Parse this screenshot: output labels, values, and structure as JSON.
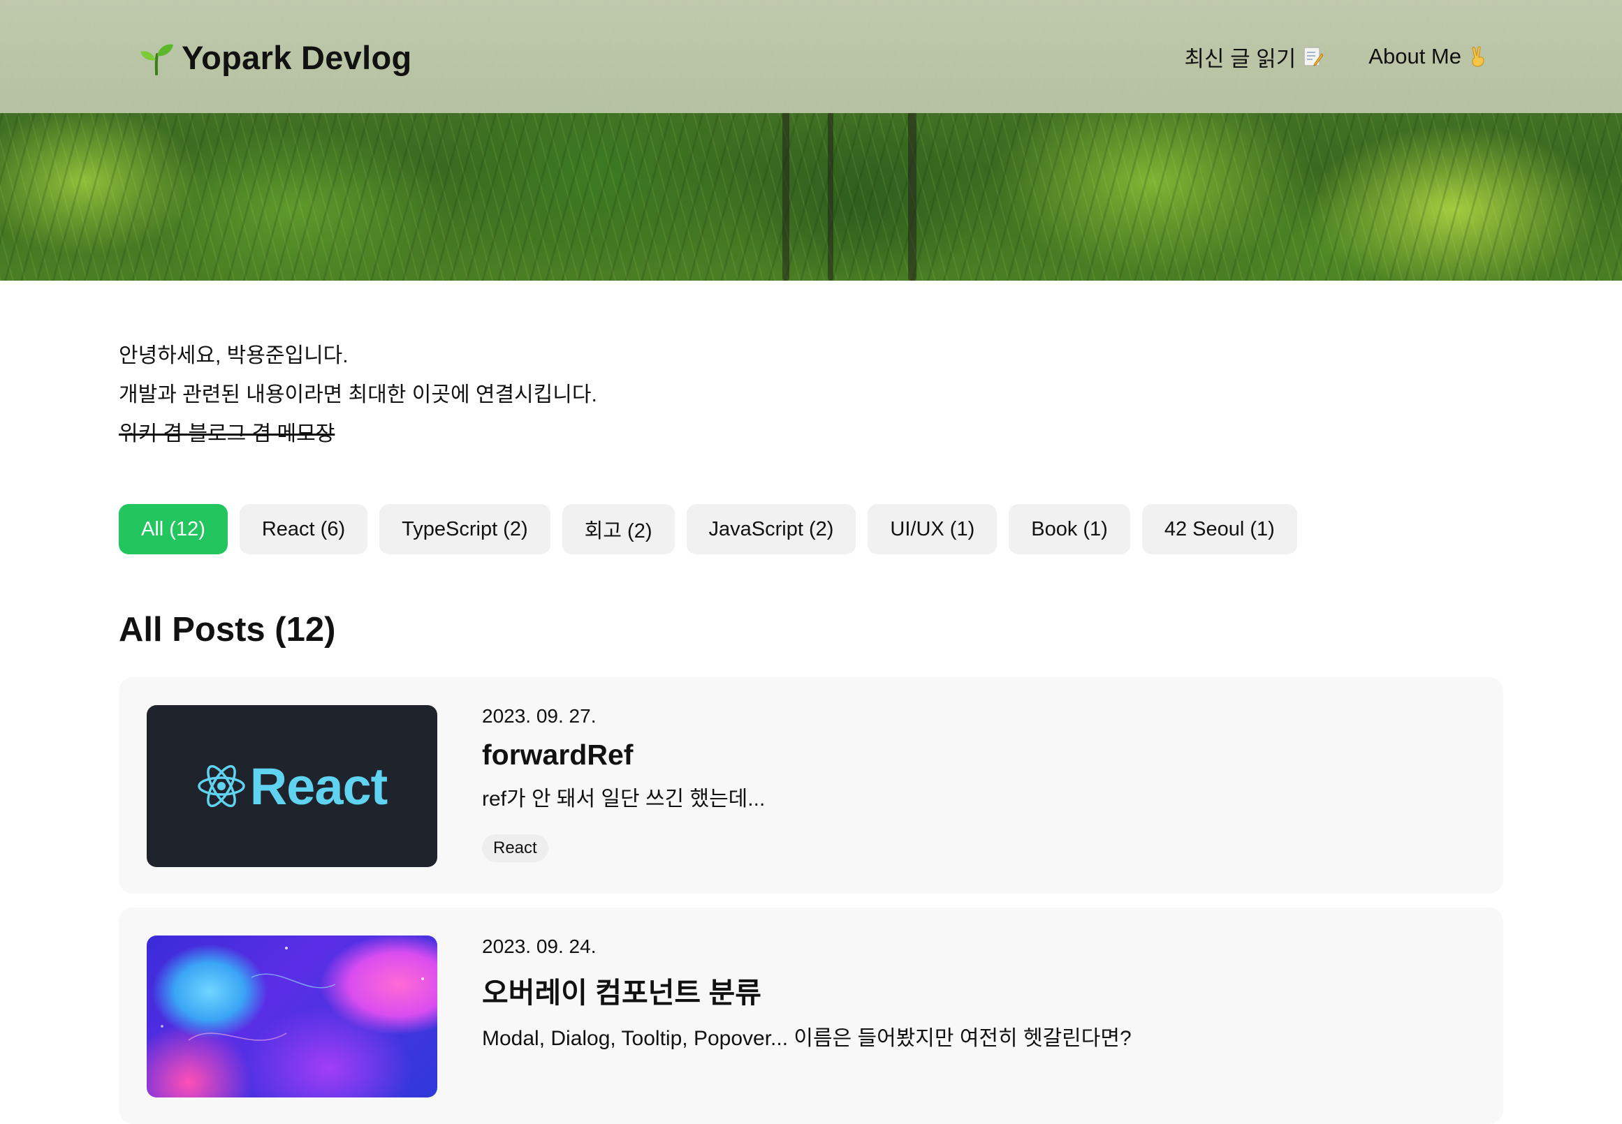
{
  "header": {
    "logo_text": "Yopark Devlog",
    "logo_icon": "sprout-icon",
    "nav": [
      {
        "label": "최신 글 읽기",
        "icon": "memo-icon"
      },
      {
        "label": "About Me",
        "icon": "victory-hand-icon"
      }
    ]
  },
  "intro": {
    "line1": "안녕하세요, 박용준입니다.",
    "line2": "개발과 관련된 내용이라면 최대한 이곳에 연결시킵니다.",
    "line3_strike": "위키 겸 블로그 겸 메모장"
  },
  "categories": [
    {
      "label": "All (12)",
      "active": true
    },
    {
      "label": "React (6)",
      "active": false
    },
    {
      "label": "TypeScript (2)",
      "active": false
    },
    {
      "label": "회고 (2)",
      "active": false
    },
    {
      "label": "JavaScript (2)",
      "active": false
    },
    {
      "label": "UI/UX (1)",
      "active": false
    },
    {
      "label": "Book (1)",
      "active": false
    },
    {
      "label": "42 Seoul (1)",
      "active": false
    }
  ],
  "posts_section": {
    "title": "All Posts (12)"
  },
  "posts": [
    {
      "date": "2023. 09. 27.",
      "title": "forwardRef",
      "description": "ref가 안 돼서 일단 쓰긴 했는데...",
      "tag": "React",
      "thumbnail_text": "React"
    },
    {
      "date": "2023. 09. 24.",
      "title": "오버레이 컴포넌트 분류",
      "description": "Modal, Dialog, Tooltip, Popover... 이름은 들어봤지만 여전히 헷갈린다면?"
    }
  ],
  "colors": {
    "accent": "#22c55e",
    "chip_bg": "#f1f1f1",
    "card_bg": "#f8f8f8",
    "react_blue": "#5fd3f0"
  }
}
